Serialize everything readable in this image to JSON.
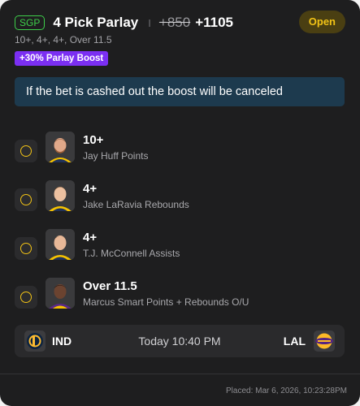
{
  "bet": {
    "badge": "SGP",
    "title": "4 Pick Parlay",
    "separator": "I",
    "odds_original": "+850",
    "odds_boosted": "+1105",
    "status": "Open",
    "legs_summary": "10+, 4+, 4+, Over 11.5",
    "boost_label": "+30% Parlay Boost",
    "notice": "If the bet is cashed out the boost will be canceled"
  },
  "legs": [
    {
      "line": "10+",
      "market": "Jay Huff Points",
      "avatar": "player-photo-jay-huff"
    },
    {
      "line": "4+",
      "market": "Jake LaRavia Rebounds",
      "avatar": "player-photo-jake-laravia"
    },
    {
      "line": "4+",
      "market": "T.J. McConnell Assists",
      "avatar": "player-photo-tj-mcconnell"
    },
    {
      "line": "Over 11.5",
      "market": "Marcus Smart Points + Rebounds O/U",
      "avatar": "player-photo-marcus-smart"
    }
  ],
  "game": {
    "away_team": "IND",
    "home_team": "LAL",
    "time": "Today 10:40 PM",
    "away_logo": "pacers-logo",
    "home_logo": "lakers-logo"
  },
  "placed": "Placed: Mar 6, 2026, 10:23:28PM",
  "colors": {
    "accent_yellow": "#f2c316",
    "sgp_green": "#3ecf4a",
    "boost_purple": "#7b2ff2",
    "notice_blue": "#1d3a4e",
    "card_bg": "#1e1e1f"
  }
}
